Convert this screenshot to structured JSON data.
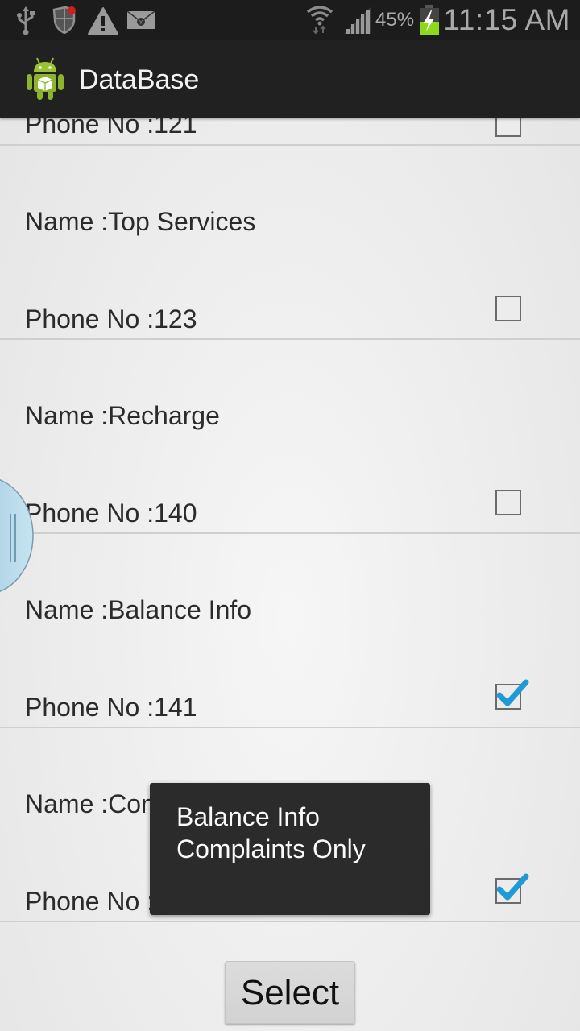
{
  "status_bar": {
    "icons_left": [
      "usb-icon",
      "security-shield-icon",
      "warning-icon",
      "email-icon"
    ],
    "icons_right": [
      "wifi-icon",
      "signal-icon",
      "battery-charging-icon"
    ],
    "battery_percent": "45%",
    "time": "11:15 AM",
    "colors": {
      "battery_fill": "#8ed81c",
      "notification_dot": "#cc1f1f"
    }
  },
  "action_bar": {
    "title": "DataBase",
    "icon": "android-app-icon"
  },
  "list": {
    "items": [
      {
        "name": "",
        "phone": "Phone No :121",
        "checked": false
      },
      {
        "name": "Name :Top Services",
        "phone": "Phone No :123",
        "checked": false
      },
      {
        "name": "Name :Recharge",
        "phone": "Phone No :140",
        "checked": false
      },
      {
        "name": "Name :Balance Info",
        "phone": "Phone No :141",
        "checked": true
      },
      {
        "name": "Name :Complaints Only",
        "phone": "Phone No :198",
        "checked": true
      }
    ]
  },
  "toast": {
    "lines": [
      "Balance Info",
      "Complaints Only"
    ]
  },
  "select_button": {
    "label": "Select"
  },
  "accent_color": "#1e9bd7"
}
